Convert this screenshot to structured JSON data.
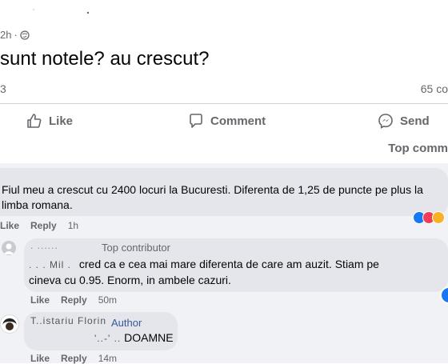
{
  "post": {
    "time": "2h",
    "privacy_icon": "globe-icon",
    "text": "sunt notele? au crescut?",
    "reaction_count": "3",
    "comment_count": "65 co"
  },
  "actions": {
    "like": "Like",
    "comment": "Comment",
    "send": "Send"
  },
  "sort_label": "Top comm",
  "comments": [
    {
      "text_line1": "Fiul meu a crescut cu 2400 locuri la Bucuresti. Diferenta de 1,25 de puncte pe plus la",
      "text_line2": "limba romana.",
      "like": "Like",
      "reply": "Reply",
      "time": "1h",
      "reaction_icons": [
        "like-reaction-icon",
        "love-reaction-icon",
        "wow-reaction-icon"
      ]
    },
    {
      "name": ". ......",
      "badge": "Top contributor",
      "text_prefix": ". .  .   Mil  .",
      "text_line1": "cred ca e cea mai mare diferenta de care am auzit. Stiam pe",
      "text_line2": "cineva cu 0.95. Enorm, in ambele cazuri.",
      "like": "Like",
      "reply": "Reply",
      "time": "50m"
    },
    {
      "name": "T..istariu Florin",
      "badge": "Author",
      "text_prefix": "'..-' ..",
      "text": "DOAMNE",
      "like": "Like",
      "reply": "Reply",
      "time": "14m"
    }
  ],
  "colors": {
    "text_primary": "#050505",
    "text_secondary": "#65676b",
    "comment_bubble": "#e4e6eb",
    "comment_area": "#f0f2f5",
    "like_blue": "#1877f2",
    "love_red": "#f33e58",
    "wow_yellow": "#f7b125"
  }
}
